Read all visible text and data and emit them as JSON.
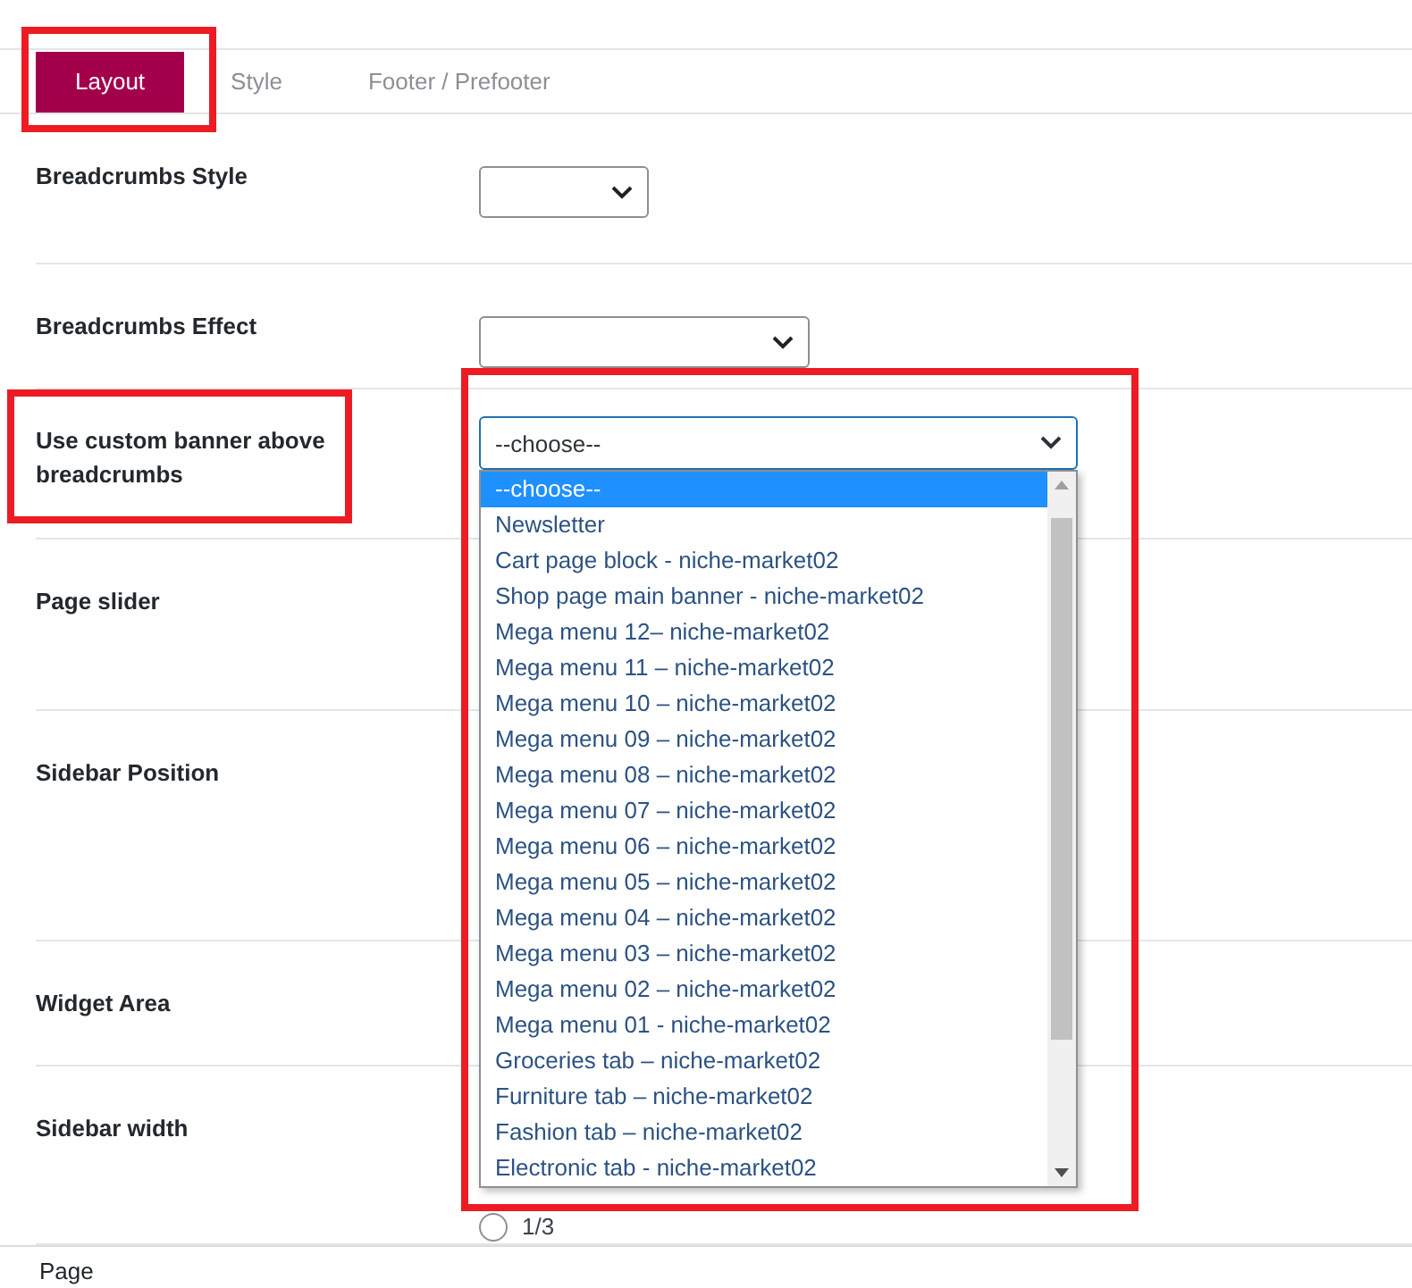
{
  "tabs": [
    {
      "label": "Layout",
      "selected": true
    },
    {
      "label": "Style",
      "selected": false
    },
    {
      "label": "Footer / Prefooter",
      "selected": false
    }
  ],
  "fields": [
    {
      "label": "Breadcrumbs Style",
      "kind": "select"
    },
    {
      "label": "Breadcrumbs Effect",
      "kind": "select"
    },
    {
      "label": "Use custom banner above breadcrumbs",
      "kind": "open-select"
    },
    {
      "label": "Page slider",
      "kind": "hidden"
    },
    {
      "label": "Sidebar Position",
      "kind": "hidden"
    },
    {
      "label": "Widget Area",
      "kind": "hidden"
    },
    {
      "label": "Sidebar width",
      "kind": "radios",
      "options": [
        {
          "label": "1/3",
          "selected": false
        }
      ]
    }
  ],
  "dropdown": {
    "value": "--choose--",
    "options": [
      {
        "label": "--choose--",
        "selected": true
      },
      {
        "label": "Newsletter",
        "selected": false
      },
      {
        "label": "Cart page block - niche-market02",
        "selected": false
      },
      {
        "label": "Shop page main banner - niche-market02",
        "selected": false
      },
      {
        "label": "Mega menu 12– niche-market02",
        "selected": false
      },
      {
        "label": "Mega menu 11 – niche-market02",
        "selected": false
      },
      {
        "label": "Mega menu 10 – niche-market02",
        "selected": false
      },
      {
        "label": "Mega menu 09 – niche-market02",
        "selected": false
      },
      {
        "label": "Mega menu 08 – niche-market02",
        "selected": false
      },
      {
        "label": "Mega menu 07 – niche-market02",
        "selected": false
      },
      {
        "label": "Mega menu 06 – niche-market02",
        "selected": false
      },
      {
        "label": "Mega menu 05 – niche-market02",
        "selected": false
      },
      {
        "label": "Mega menu 04 – niche-market02",
        "selected": false
      },
      {
        "label": "Mega menu 03 – niche-market02",
        "selected": false
      },
      {
        "label": "Mega menu 02 – niche-market02",
        "selected": false
      },
      {
        "label": "Mega menu 01 - niche-market02",
        "selected": false
      },
      {
        "label": "Groceries tab – niche-market02",
        "selected": false
      },
      {
        "label": "Furniture tab – niche-market02",
        "selected": false
      },
      {
        "label": "Fashion tab – niche-market02",
        "selected": false
      },
      {
        "label": "Electronic tab - niche-market02",
        "selected": false
      }
    ]
  },
  "footer": {
    "label": "Page"
  }
}
